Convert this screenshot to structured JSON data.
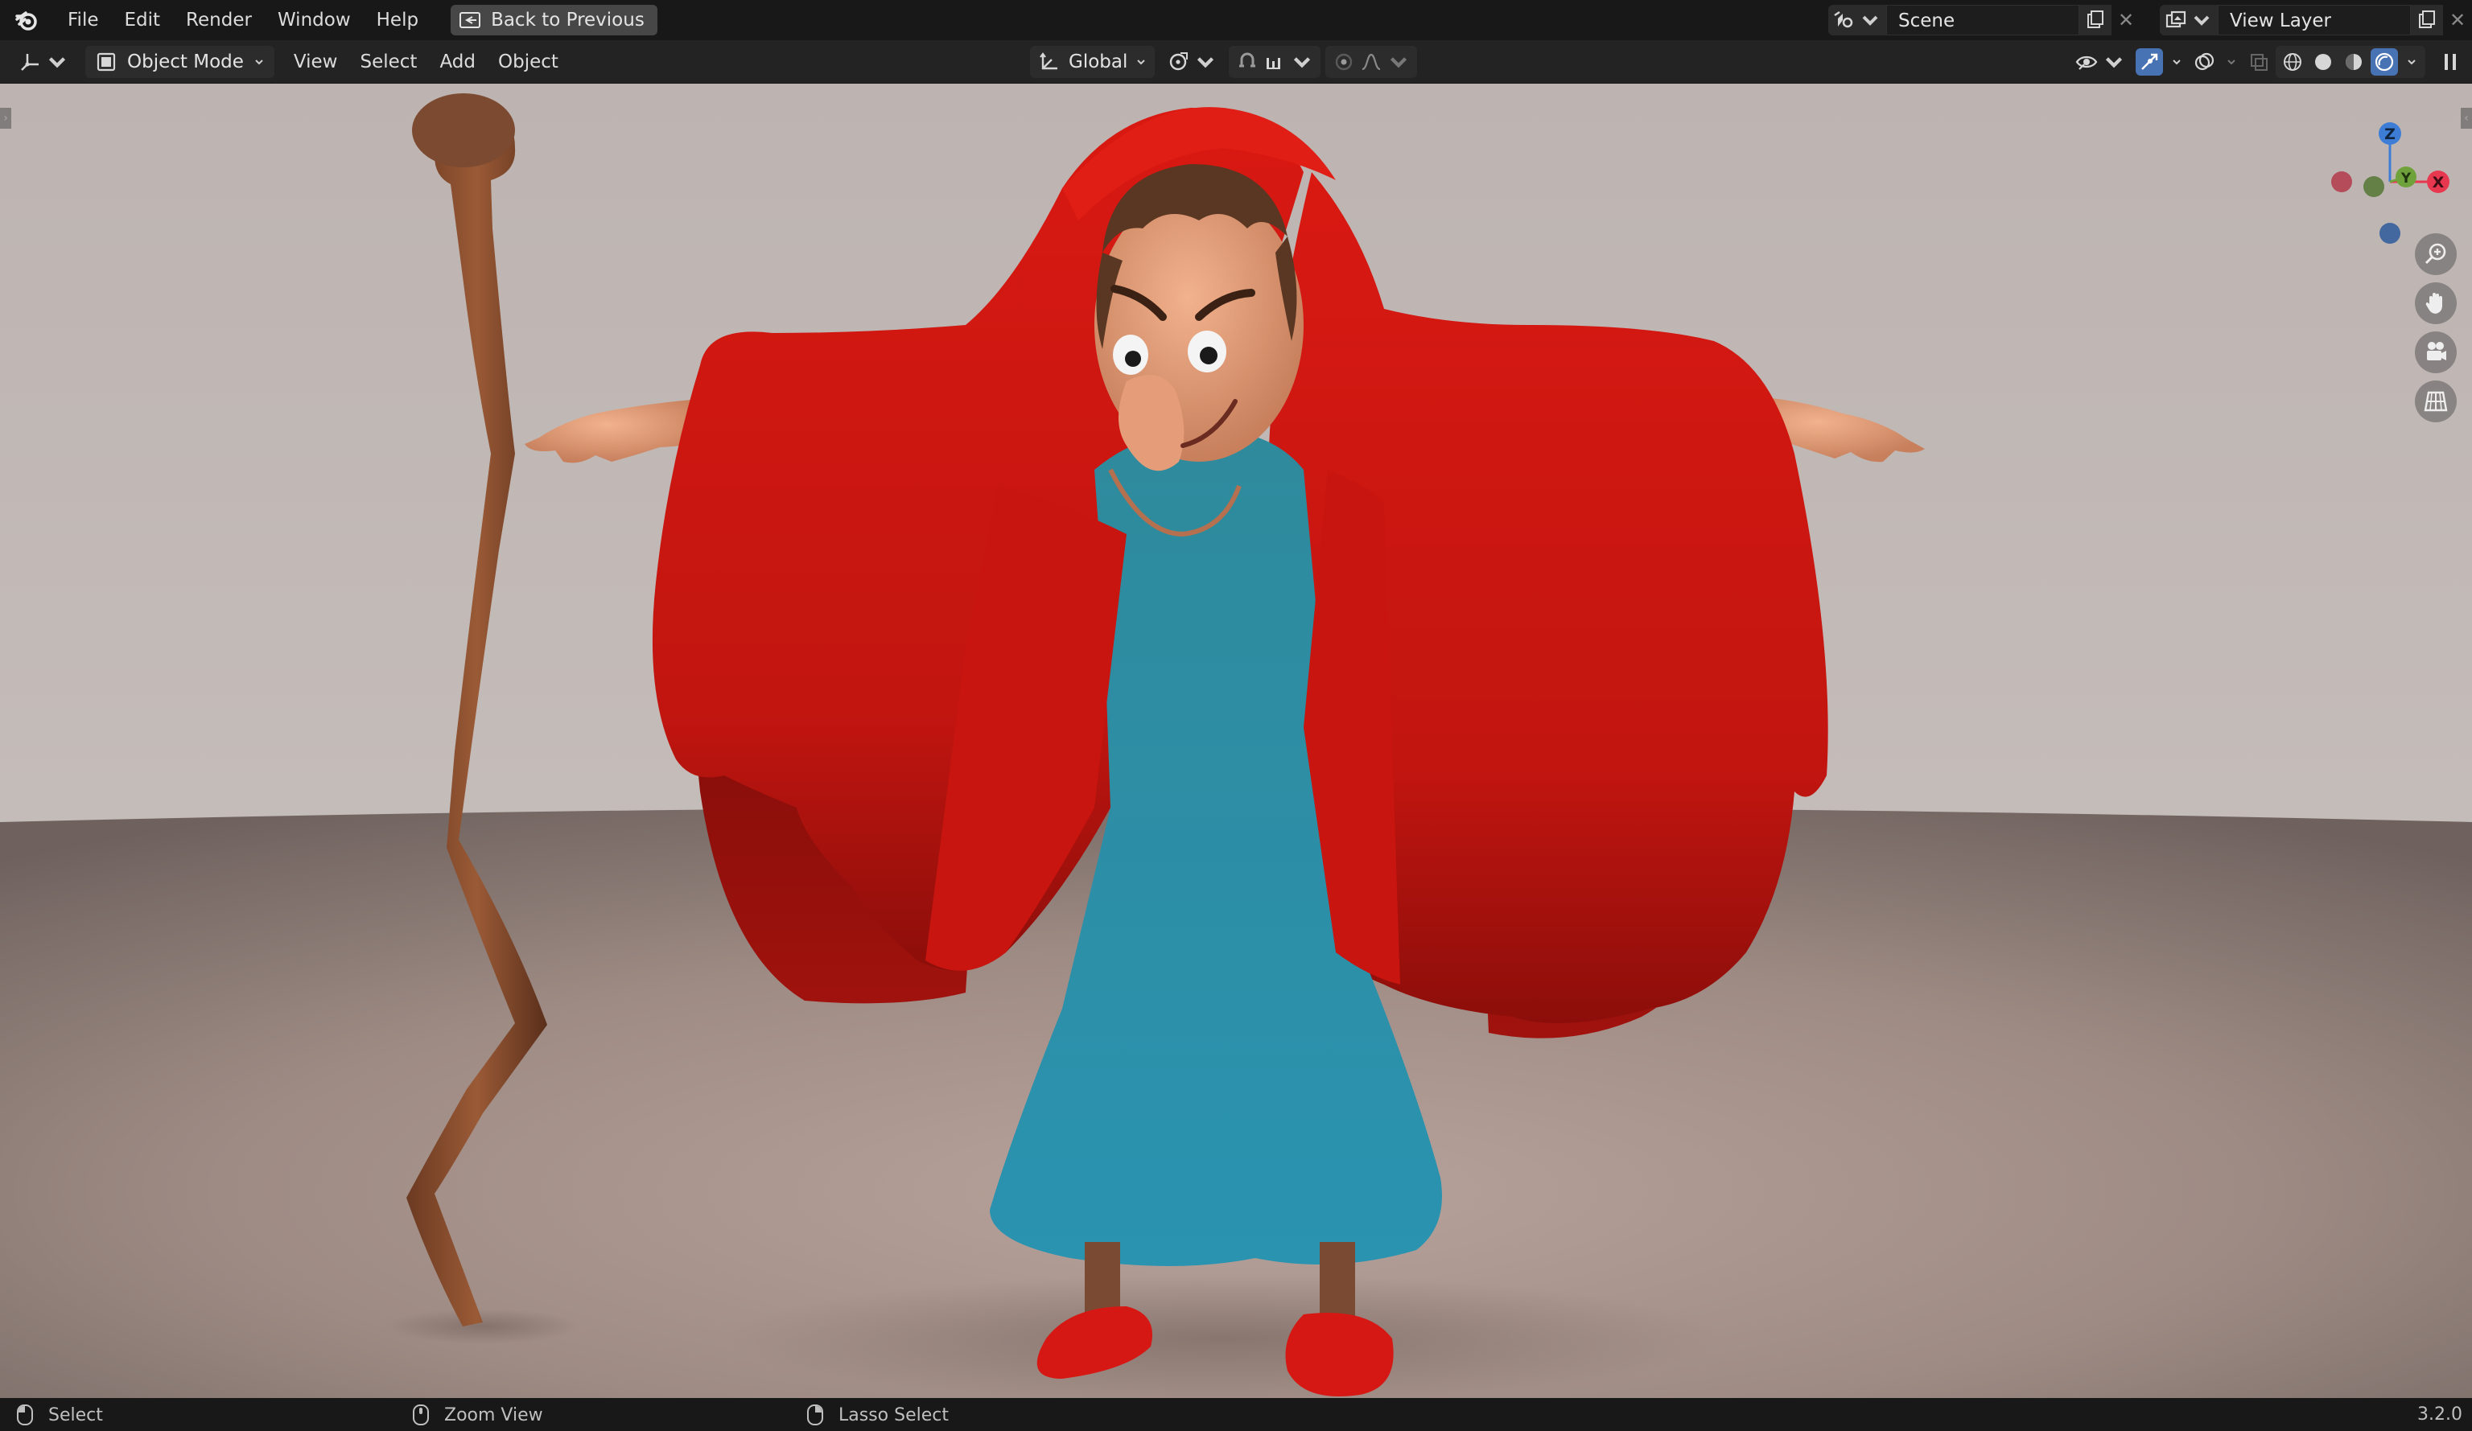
{
  "topbar": {
    "menus": [
      "File",
      "Edit",
      "Render",
      "Window",
      "Help"
    ],
    "back_label": "Back to Previous",
    "scene_name": "Scene",
    "view_layer_name": "View Layer"
  },
  "header": {
    "mode_label": "Object Mode",
    "menus": [
      "View",
      "Select",
      "Add",
      "Object"
    ],
    "orientation_label": "Global"
  },
  "gizmo": {
    "z_label": "Z",
    "y_label": "Y",
    "x_label": "X",
    "colors": {
      "x": "#e8384f",
      "y": "#6fa23a",
      "z": "#3d7dd6"
    }
  },
  "statusbar": {
    "left_action": "Select",
    "middle_action": "Zoom View",
    "right_action": "Lasso Select",
    "version": "3.2.0"
  },
  "icons": [
    "blender-logo-icon",
    "back-icon",
    "scene-icon",
    "new-scene-icon",
    "view-layer-icon",
    "editor-type-icon",
    "object-mode-icon",
    "transform-orientation-icon",
    "pivot-icon",
    "snap-icon",
    "proportional-icon",
    "visibility-icon",
    "gizmo-icon",
    "overlay-icon",
    "xray-icon",
    "wireframe-shading-icon",
    "solid-shading-icon",
    "material-shading-icon",
    "rendered-shading-icon",
    "zoom-icon",
    "hand-icon",
    "camera-icon",
    "grid-icon",
    "mouse-left-icon",
    "mouse-middle-icon",
    "mouse-right-icon"
  ]
}
